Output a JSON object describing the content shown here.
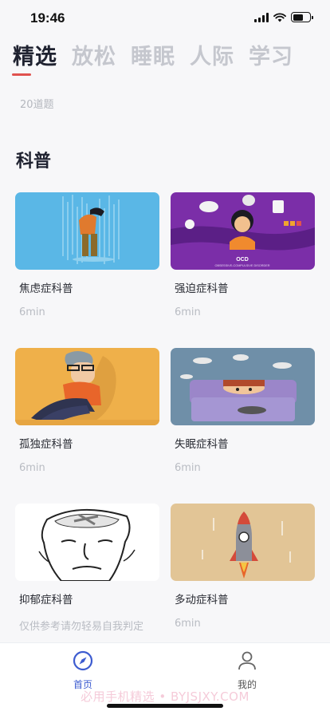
{
  "status": {
    "time": "19:46",
    "battery_level": 0.6
  },
  "tabs": [
    {
      "label": "精选",
      "active": true
    },
    {
      "label": "放松",
      "active": false
    },
    {
      "label": "睡眠",
      "active": false
    },
    {
      "label": "人际",
      "active": false
    },
    {
      "label": "学习",
      "active": false
    }
  ],
  "previous": {
    "meta": "20道题"
  },
  "section": {
    "title": "科普"
  },
  "cards": [
    {
      "title": "焦虑症科普",
      "meta": "6min",
      "icon": "rain-person-illustration"
    },
    {
      "title": "强迫症科普",
      "meta": "6min",
      "icon": "ocd-illustration",
      "image_caption": "OCD",
      "image_subcaption": "OBSESSIVE-COMPULSIVE DISORDER"
    },
    {
      "title": "孤独症科普",
      "meta": "6min",
      "icon": "sitting-person-illustration"
    },
    {
      "title": "失眠症科普",
      "meta": "6min",
      "icon": "sleepless-illustration"
    },
    {
      "title": "抑郁症科普",
      "meta": "仅供参考请勿轻易自我判定",
      "icon": "head-sketch-illustration"
    },
    {
      "title": "多动症科普",
      "meta": "6min",
      "icon": "rocket-illustration"
    }
  ],
  "tabbar": {
    "home_label": "首页",
    "mine_label": "我的"
  },
  "watermark": "必用手机精选 • BYJSJXY.COM",
  "colors": {
    "accent": "#3d5cd0",
    "tab_indicator": "#e0524f"
  }
}
